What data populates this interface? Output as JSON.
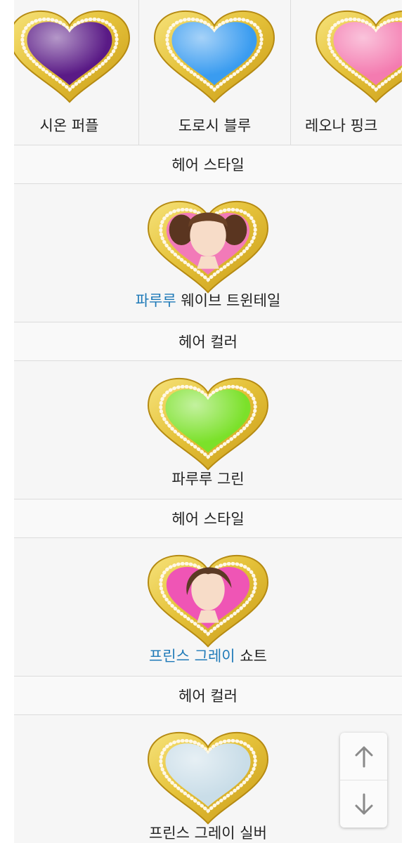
{
  "top_row": {
    "items": [
      {
        "label": "시온 퍼플",
        "icon": "purple-heart-icon",
        "color": "#5a1a86"
      },
      {
        "label": "도로시 블루",
        "icon": "blue-heart-icon",
        "color": "#3a9cf0"
      },
      {
        "label": "레오나 핑크",
        "icon": "pink-heart-icon",
        "color": "#f47bb0"
      }
    ]
  },
  "sections": [
    {
      "header": "헤어 스타일",
      "link": "파루루",
      "suffix": " 웨이브 트윈테일",
      "icon": "twintail-hair-heart-icon"
    },
    {
      "header": "헤어 컬러",
      "label": "파루루 그린",
      "icon": "green-heart-icon",
      "color": "#7be12a"
    },
    {
      "header": "헤어 스타일",
      "link": "프린스 그레이",
      "suffix": " 쇼트",
      "icon": "short-hair-heart-icon"
    },
    {
      "header": "헤어 컬러",
      "label": "프린스 그레이 실버",
      "icon": "silver-heart-icon",
      "color": "#c9dde8"
    }
  ],
  "scroll": {
    "up_icon": "arrow-up-icon",
    "down_icon": "arrow-down-icon"
  }
}
